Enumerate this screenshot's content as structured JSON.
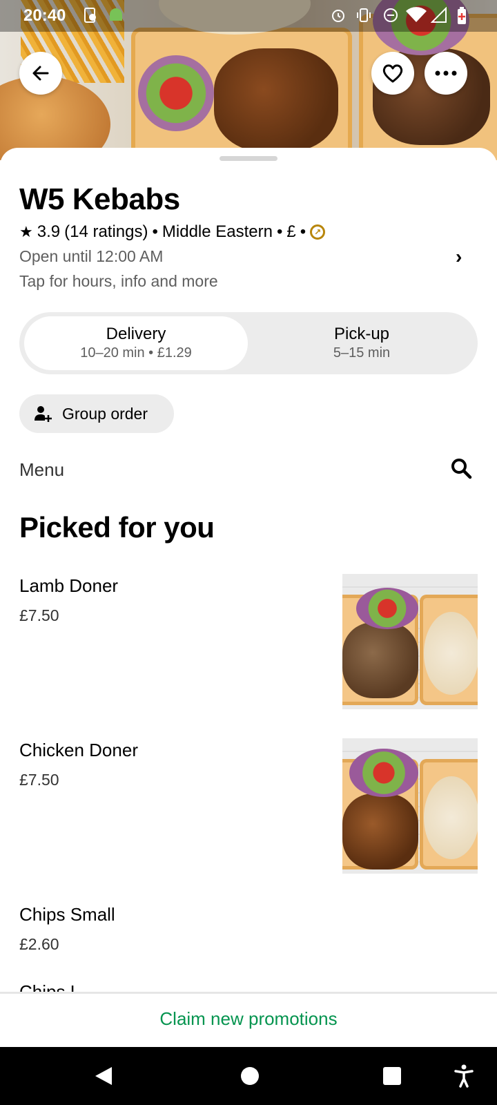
{
  "status_bar": {
    "time": "20:40",
    "icons": [
      "sync-icon",
      "android-icon",
      "alarm-icon",
      "vibrate-icon",
      "dnd-icon",
      "wifi-icon",
      "signal-icon",
      "battery-icon"
    ]
  },
  "header": {
    "back_icon": "arrow-left-icon",
    "favorite_icon": "heart-icon",
    "more_icon": "more-horizontal-icon"
  },
  "store": {
    "name": "W5 Kebabs",
    "rating": "3.9",
    "ratings_count": "(14 ratings)",
    "cuisine": "Middle Eastern",
    "price_level": "£",
    "hours": "Open until 12:00 AM",
    "info_hint": "Tap for hours, info and more"
  },
  "fulfillment": {
    "options": [
      {
        "label": "Delivery",
        "detail": "10–20 min • £1.29",
        "selected": true
      },
      {
        "label": "Pick-up",
        "detail": "5–15 min",
        "selected": false
      }
    ]
  },
  "group_order": {
    "label": "Group order"
  },
  "menu": {
    "label": "Menu"
  },
  "section": {
    "title": "Picked for you",
    "items": [
      {
        "name": "Lamb Doner",
        "price": "£7.50",
        "has_image": true
      },
      {
        "name": "Chicken Doner",
        "price": "£7.50",
        "has_image": true
      },
      {
        "name": "Chips Small",
        "price": "£2.60",
        "has_image": false
      },
      {
        "name": "Chips L",
        "price": "",
        "has_image": false
      }
    ]
  },
  "promo_bar": {
    "label": "Claim new promotions",
    "color": "#05944f"
  },
  "nav_bar": {
    "icons": [
      "back-triangle-icon",
      "home-circle-icon",
      "recents-square-icon",
      "accessibility-icon"
    ]
  }
}
